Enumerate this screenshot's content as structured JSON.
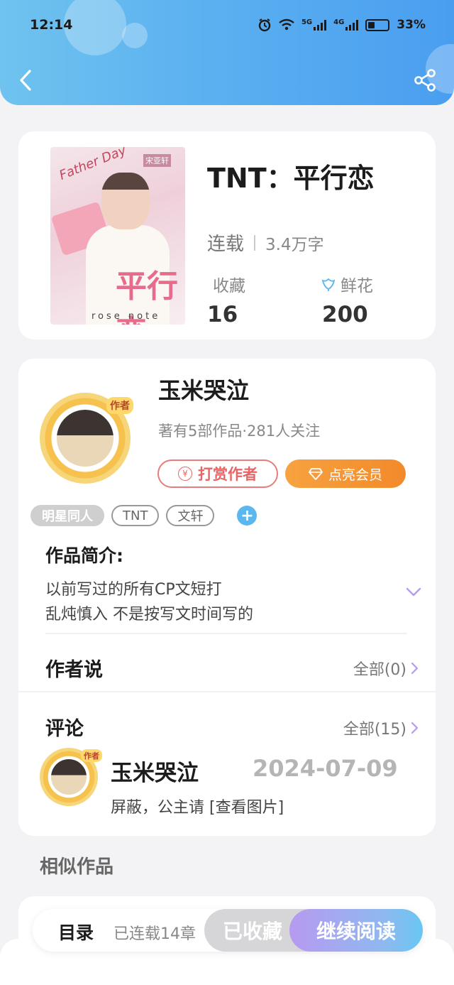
{
  "status_bar": {
    "time": "12:14",
    "net1": "5G",
    "net2": "4G",
    "battery": "33%"
  },
  "book": {
    "title": "TNT：平行恋",
    "status": "连载",
    "word_count": "3.4万字",
    "favorites_label": "收藏",
    "favorites_value": "16",
    "flowers_label": "鲜花",
    "flowers_value": "200",
    "cover": {
      "signature": "Father Day",
      "title_art": "平行恋",
      "tag": "宋亚轩",
      "footer": "rose note"
    }
  },
  "author": {
    "name": "玉米哭泣",
    "badge": "作者",
    "summary": "著有5部作品·281人关注",
    "tip_button": "打赏作者",
    "tip_icon_glyph": "¥",
    "vip_button": "点亮会员"
  },
  "tags": [
    "明星同人",
    "TNT",
    "文轩"
  ],
  "intro": {
    "title": "作品简介:",
    "line1": "以前写过的所有CP文短打",
    "line2": "乱炖慎入   不是按写文时间写的"
  },
  "author_says": {
    "title": "作者说",
    "all_label": "全部(0)"
  },
  "comments": {
    "title": "评论",
    "all_label": "全部(15)",
    "items": [
      {
        "user": "玉米哭泣",
        "badge": "作者",
        "date": "2024-07-09",
        "text": "屏蔽，公主请 [查看图片]"
      }
    ]
  },
  "similar": {
    "title": "相似作品"
  },
  "bottom_bar": {
    "toc": "目录",
    "chapters": "已连载14章",
    "collected": "已收藏",
    "continue": "继续阅读"
  },
  "colors": {
    "header_start": "#6fc3ef",
    "header_end": "#4a9ef0",
    "tip_red": "#e86565",
    "vip_orange": "#f28a2a",
    "accent_purple": "#b79af0"
  }
}
